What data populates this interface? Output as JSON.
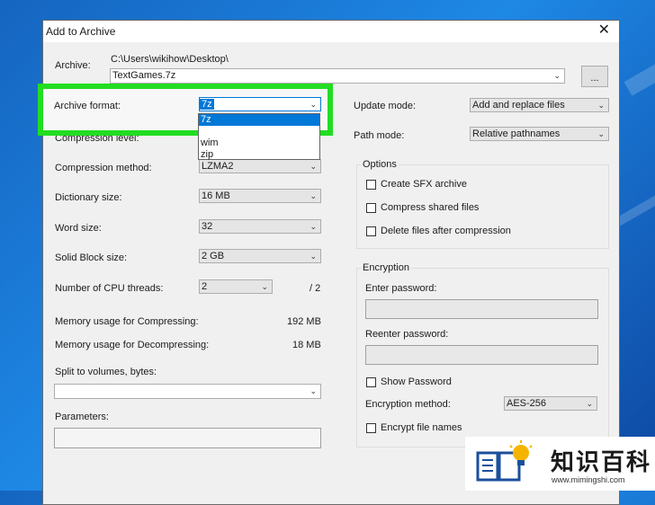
{
  "window": {
    "title": "Add to Archive",
    "close_glyph": "✕"
  },
  "archive": {
    "label": "Archive:",
    "path": "C:\\Users\\wikihow\\Desktop\\",
    "filename": "TextGames.7z",
    "browse_label": "..."
  },
  "left": {
    "archive_format": {
      "label": "Archive format:",
      "value": "7z",
      "options": [
        "7z",
        "",
        "wim",
        "zip"
      ]
    },
    "compression_level": {
      "label": "Compression level:"
    },
    "compression_method": {
      "label": "Compression method:",
      "value": "LZMA2"
    },
    "dictionary_size": {
      "label": "Dictionary size:",
      "value": "16 MB"
    },
    "word_size": {
      "label": "Word size:",
      "value": "32"
    },
    "solid_block_size": {
      "label": "Solid Block size:",
      "value": "2 GB"
    },
    "cpu_threads": {
      "label": "Number of CPU threads:",
      "value": "2",
      "max": "/ 2"
    },
    "mem_compress": {
      "label": "Memory usage for Compressing:",
      "value": "192 MB"
    },
    "mem_decompress": {
      "label": "Memory usage for Decompressing:",
      "value": "18 MB"
    },
    "split": {
      "label": "Split to volumes, bytes:",
      "value": ""
    },
    "parameters": {
      "label": "Parameters:",
      "value": ""
    }
  },
  "right": {
    "update_mode": {
      "label": "Update mode:",
      "value": "Add and replace files"
    },
    "path_mode": {
      "label": "Path mode:",
      "value": "Relative pathnames"
    },
    "options": {
      "title": "Options",
      "sfx": "Create SFX archive",
      "shared": "Compress shared files",
      "delete": "Delete files after compression"
    },
    "encryption": {
      "title": "Encryption",
      "enter_password": "Enter password:",
      "reenter_password": "Reenter password:",
      "show_password": "Show Password",
      "method_label": "Encryption method:",
      "method_value": "AES-256",
      "encrypt_names": "Encrypt file names"
    }
  },
  "watermark": {
    "brand": "知识百科",
    "url": "www.mimingshi.com"
  },
  "colors": {
    "highlight": "#22dd22",
    "selection": "#0078d7",
    "desktop": "#1e88e5"
  }
}
